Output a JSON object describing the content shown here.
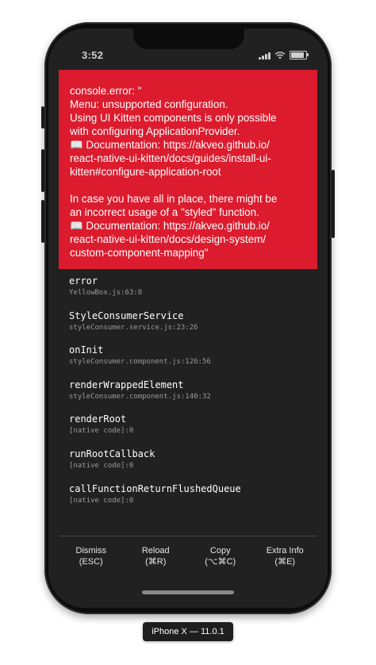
{
  "status_bar": {
    "time": "3:52"
  },
  "error": {
    "message": "console.error: \"\nMenu: unsupported configuration.\nUsing UI Kitten components is only possible\nwith configuring ApplicationProvider.\n📖 Documentation: https://akveo.github.io/\nreact-native-ui-kitten/docs/guides/install-ui-\nkitten#configure-application-root\n\nIn case you have all in place, there might be\nan incorrect usage of a \"styled\" function.\n📖 Documentation: https://akveo.github.io/\nreact-native-ui-kitten/docs/design-system/\ncustom-component-mapping\"",
    "background_color": "#dc1c2e"
  },
  "stack": [
    {
      "fn": "error",
      "loc": "YellowBox.js:63:8"
    },
    {
      "fn": "StyleConsumerService",
      "loc": "styleConsumer.service.js:23:26"
    },
    {
      "fn": "onInit",
      "loc": "styleConsumer.component.js:126:56"
    },
    {
      "fn": "renderWrappedElement",
      "loc": "styleConsumer.component.js:140:32"
    },
    {
      "fn": "renderRoot",
      "loc": "[native code]:0"
    },
    {
      "fn": "runRootCallback",
      "loc": "[native code]:0"
    },
    {
      "fn": "callFunctionReturnFlushedQueue",
      "loc": "[native code]:0"
    }
  ],
  "actions": {
    "dismiss": {
      "label": "Dismiss",
      "shortcut": "(ESC)"
    },
    "reload": {
      "label": "Reload",
      "shortcut": "(⌘R)"
    },
    "copy": {
      "label": "Copy",
      "shortcut": "(⌥⌘C)"
    },
    "extra_info": {
      "label": "Extra Info",
      "shortcut": "(⌘E)"
    }
  },
  "device_label": "iPhone X — 11.0.1"
}
